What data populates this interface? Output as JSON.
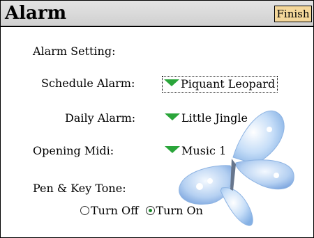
{
  "window": {
    "title": "Alarm",
    "finish_label": "Finish"
  },
  "content": {
    "section_heading": "Alarm Setting:",
    "schedule_alarm": {
      "label": "Schedule Alarm:",
      "value": "Piquant Leopard"
    },
    "daily_alarm": {
      "label": "Daily Alarm:",
      "value": "Little Jingle"
    },
    "opening_midi": {
      "label": "Opening Midi:",
      "value": "Music 1"
    },
    "pen_key_tone": {
      "label": "Pen & Key Tone:",
      "options": [
        "Turn Off",
        "Turn On"
      ],
      "selected": "Turn On"
    }
  },
  "icons": {
    "dropdown": "green-triangle-down-icon",
    "decoration": "butterfly-icon"
  },
  "colors": {
    "finish_button": "#f4d79a",
    "dropdown_arrow": "#2aa53a",
    "butterfly": "#9cc4ef"
  }
}
